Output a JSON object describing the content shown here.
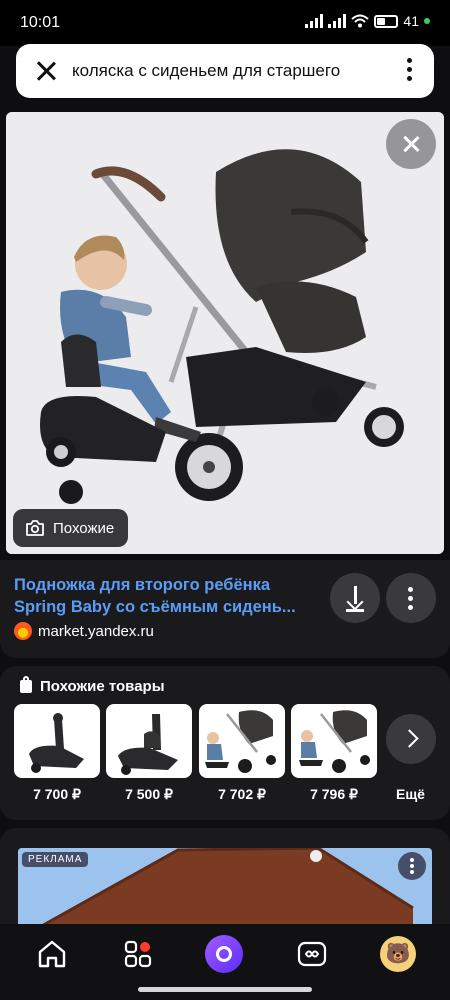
{
  "status_bar": {
    "time": "10:01",
    "battery": "41"
  },
  "search": {
    "query": "коляска с сиденьем для старшего"
  },
  "image": {
    "similar_button": "Похожие"
  },
  "result": {
    "title": "Подножка для второго ребёнка Spring Baby со съёмным сидень...",
    "source": "market.yandex.ru"
  },
  "similar_products": {
    "header": "Похожие товары",
    "items": [
      {
        "price": "7 700 ₽"
      },
      {
        "price": "7 500 ₽"
      },
      {
        "price": "7 702 ₽"
      },
      {
        "price": "7 796 ₽"
      }
    ],
    "more_label": "Ещё"
  },
  "ad": {
    "label": "РЕКЛАМА"
  },
  "colors": {
    "link": "#5b9df5",
    "alice": "#7b3cff",
    "notification": "#ff3b30"
  }
}
